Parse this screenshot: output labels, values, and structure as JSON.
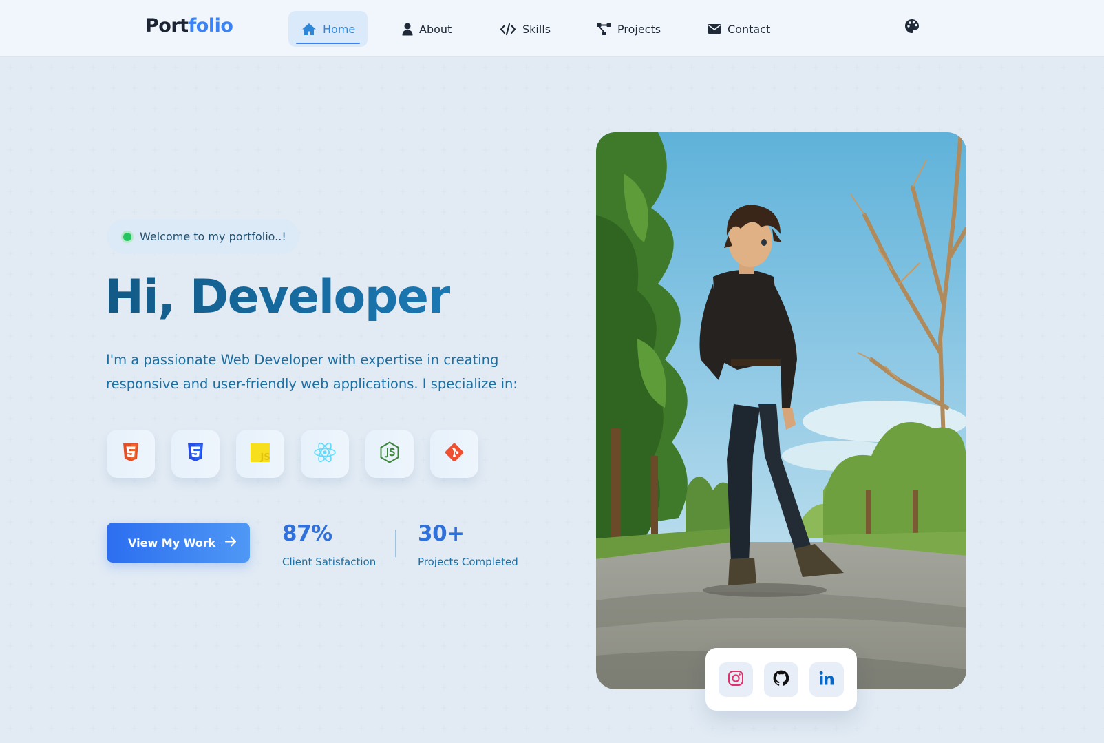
{
  "nav": {
    "logo_main": "Port",
    "logo_accent": "folio",
    "items": [
      {
        "label": "Home",
        "icon": "home-icon",
        "active": true
      },
      {
        "label": "About",
        "icon": "user-icon",
        "active": false
      },
      {
        "label": "Skills",
        "icon": "code-icon",
        "active": false
      },
      {
        "label": "Projects",
        "icon": "project-diagram-icon",
        "active": false
      },
      {
        "label": "Contact",
        "icon": "envelope-icon",
        "active": false
      }
    ],
    "theme_icon": "palette-icon"
  },
  "hero": {
    "welcome": "Welcome to my portfolio..!",
    "title": "Hi, Developer",
    "description": "I'm a passionate Web Developer with expertise in creating responsive and user-friendly web applications. I specialize in:",
    "tech": [
      {
        "name": "HTML5",
        "icon": "html5-icon",
        "color": "#e34f26"
      },
      {
        "name": "CSS3",
        "icon": "css3-icon",
        "color": "#264de4"
      },
      {
        "name": "JavaScript",
        "icon": "js-icon",
        "color": "#f7df1e"
      },
      {
        "name": "React",
        "icon": "react-icon",
        "color": "#61dafb"
      },
      {
        "name": "Node.js",
        "icon": "nodejs-icon",
        "color": "#3c873a"
      },
      {
        "name": "Git",
        "icon": "git-icon",
        "color": "#f05032"
      }
    ],
    "cta_label": "View My Work",
    "stats": [
      {
        "value": "87%",
        "label": "Client Satisfaction"
      },
      {
        "value": "30+",
        "label": "Projects Completed"
      }
    ]
  },
  "social": [
    {
      "name": "Instagram",
      "icon": "instagram-icon",
      "color": "#e1306c"
    },
    {
      "name": "GitHub",
      "icon": "github-icon",
      "color": "#111111"
    },
    {
      "name": "LinkedIn",
      "icon": "linkedin-icon",
      "color": "#0a66c2"
    }
  ],
  "colors": {
    "accent": "#3b82f6",
    "title_blue": "#17628f",
    "background": "#eff6fd"
  }
}
